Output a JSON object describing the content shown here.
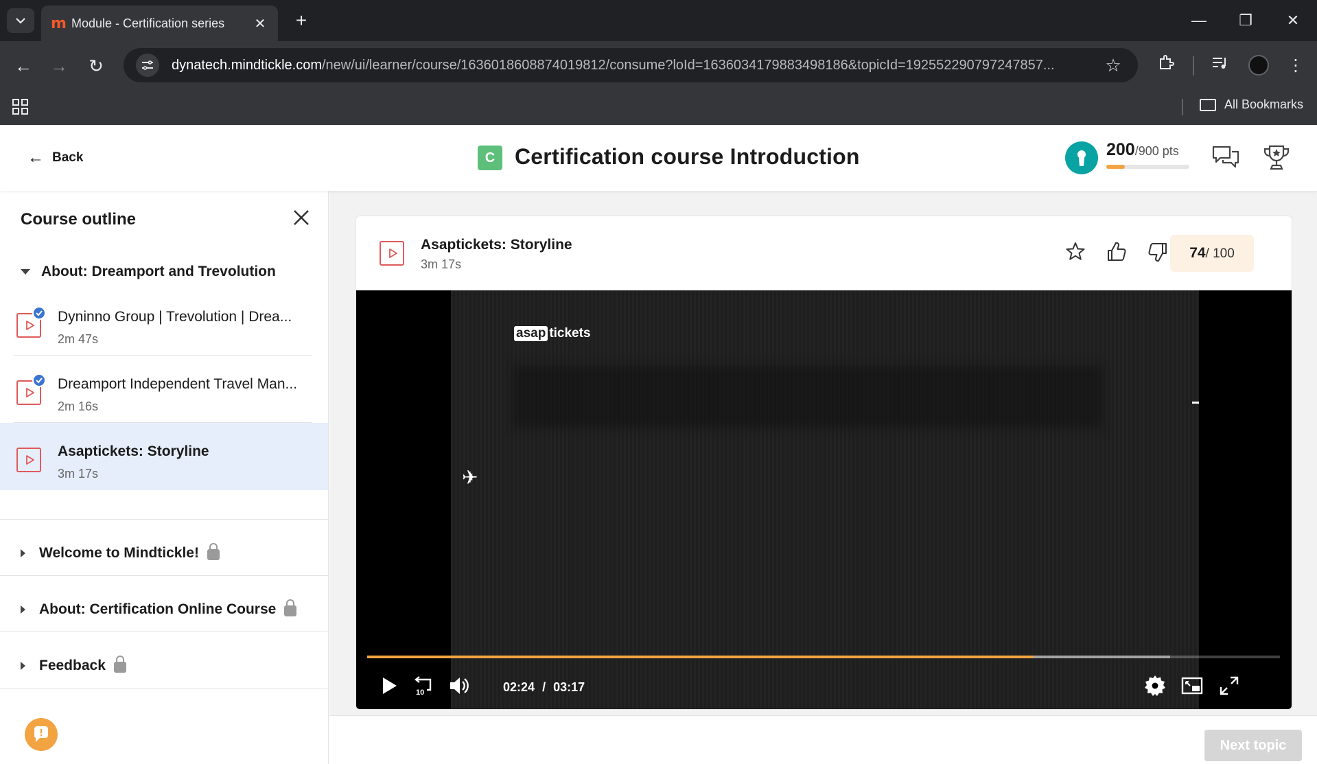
{
  "browser": {
    "tab_title": "Module - Certification series",
    "tab_favicon": "m",
    "url_host": "dynatech.mindtickle.com",
    "url_path": "/new/ui/learner/course/1636018608874019812/consume?loId=1636034179883498186&topicId=192552290797247857...",
    "bookmarks_label": "All Bookmarks"
  },
  "header": {
    "back_label": "Back",
    "course_badge": "C",
    "course_title": "Certification course Introduction",
    "points_earned": "200",
    "points_total": "/900 pts",
    "points_progress": 0.22
  },
  "sidebar": {
    "title": "Course outline",
    "open_section": "About: Dreamport and Trevolution",
    "topics": [
      {
        "name": "Dyninno Group | Trevolution | Drea...",
        "duration": "2m 47s",
        "completed": true
      },
      {
        "name": "Dreamport Independent Travel Man...",
        "duration": "2m 16s",
        "completed": true
      },
      {
        "name": "Asaptickets: Storyline",
        "duration": "3m 17s",
        "completed": false,
        "active": true
      }
    ],
    "locked_sections": [
      "Welcome to Mindtickle!",
      "About: Certification Online Course",
      "Feedback"
    ]
  },
  "content": {
    "title": "Asaptickets: Storyline",
    "duration": "3m 17s",
    "score_earned": "74",
    "score_total": "/ 100",
    "video": {
      "logo_part1": "asap",
      "logo_part2": "tickets",
      "current_time": "02:24",
      "separator": "/",
      "total_time": "03:17",
      "played_fraction": 0.73,
      "buffered_fraction": 0.88,
      "rewind_seconds": "10"
    },
    "next_button": "Next topic"
  },
  "colors": {
    "accent_orange": "#f3a442",
    "active_row": "#e6eefb",
    "video_icon_red": "#e05a5a",
    "check_blue": "#3b74d1",
    "badge_green": "#5dbf7a",
    "avatar_teal": "#0aa3a3"
  }
}
